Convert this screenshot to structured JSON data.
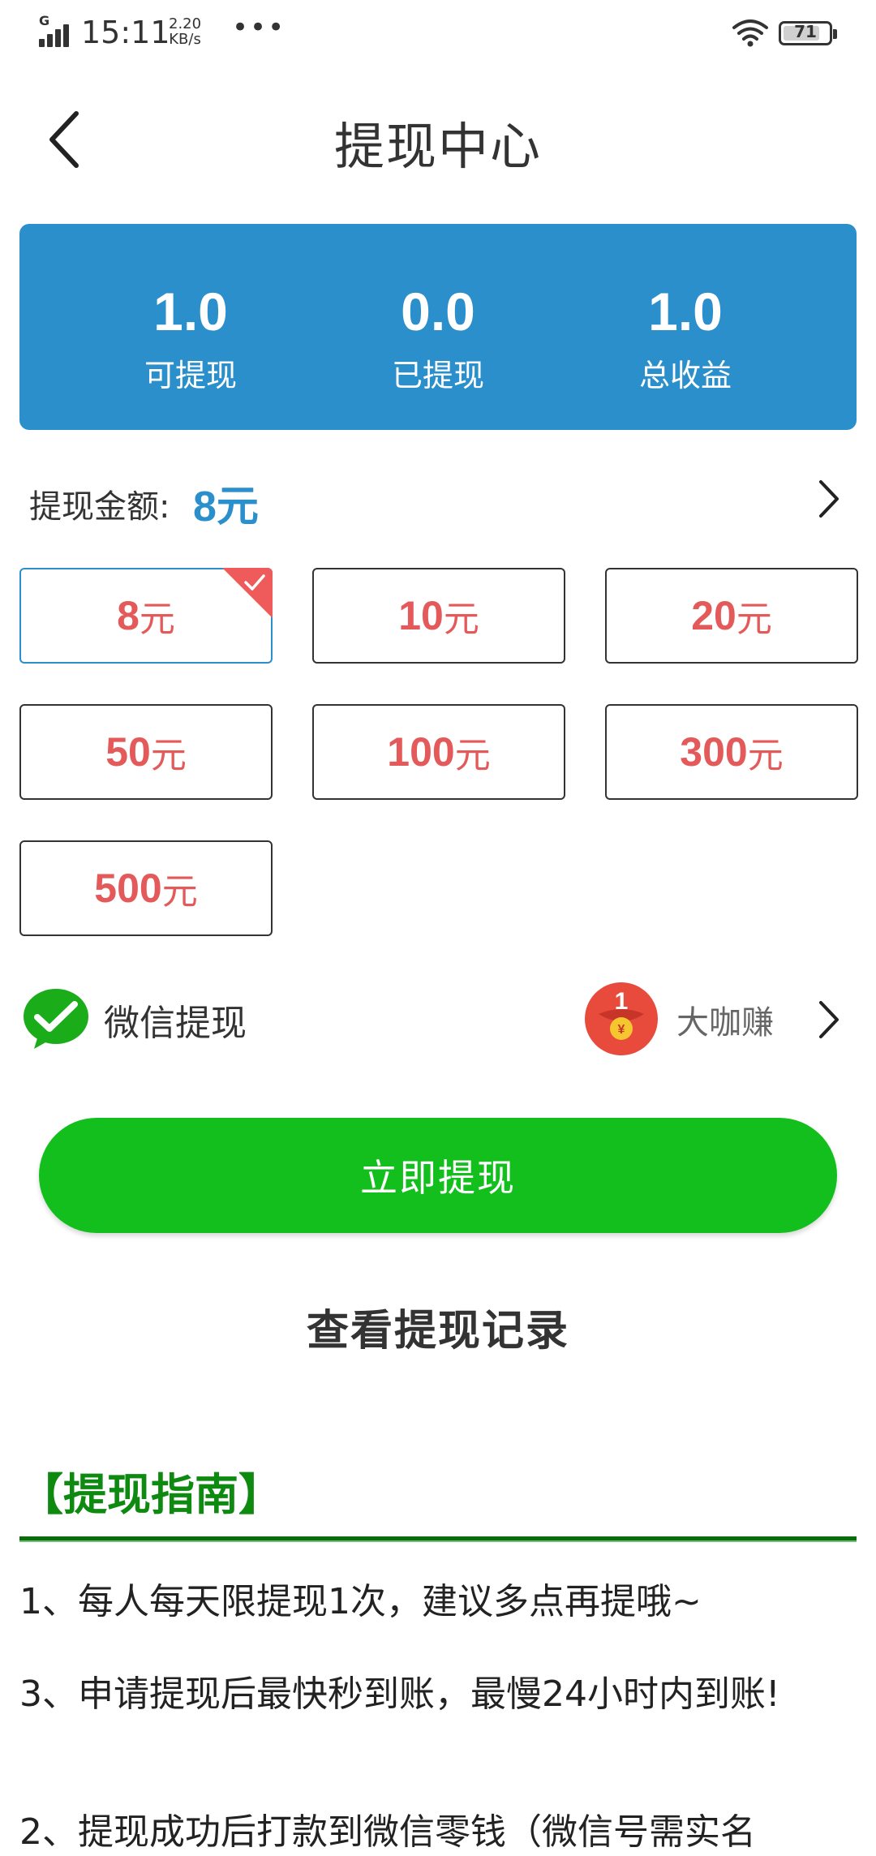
{
  "status_bar": {
    "network": "G",
    "time": "15:11",
    "speed_value": "2.20",
    "speed_unit": "KB/s",
    "more": "•••",
    "battery": "71"
  },
  "header": {
    "title": "提现中心"
  },
  "stats": [
    {
      "value": "1.0",
      "label": "可提现"
    },
    {
      "value": "0.0",
      "label": "已提现"
    },
    {
      "value": "1.0",
      "label": "总收益"
    }
  ],
  "amount": {
    "label": "提现金额:",
    "value": "8元"
  },
  "options": [
    {
      "num": "8",
      "unit": "元"
    },
    {
      "num": "10",
      "unit": "元"
    },
    {
      "num": "20",
      "unit": "元"
    },
    {
      "num": "50",
      "unit": "元"
    },
    {
      "num": "100",
      "unit": "元"
    },
    {
      "num": "300",
      "unit": "元"
    },
    {
      "num": "500",
      "unit": "元"
    }
  ],
  "selected_option_index": 0,
  "payment": {
    "method_label": "微信提现",
    "app_badge_number": "1",
    "app_badge_currency": "¥",
    "app_name": "大咖赚"
  },
  "actions": {
    "withdraw_label": "立即提现",
    "record_label": "查看提现记录"
  },
  "guide": {
    "title": "【提现指南】",
    "items": [
      "1、每人每天限提现1次，建议多点再提哦~",
      "3、申请提现后最快秒到账，最慢24小时内到账!",
      "2、提现成功后打款到微信零钱（微信号需实名"
    ]
  },
  "colors": {
    "primary_blue": "#2b8fcc",
    "amount_red": "#e45a5a",
    "button_green": "#12bf1c",
    "guide_green": "#0f8a11"
  }
}
